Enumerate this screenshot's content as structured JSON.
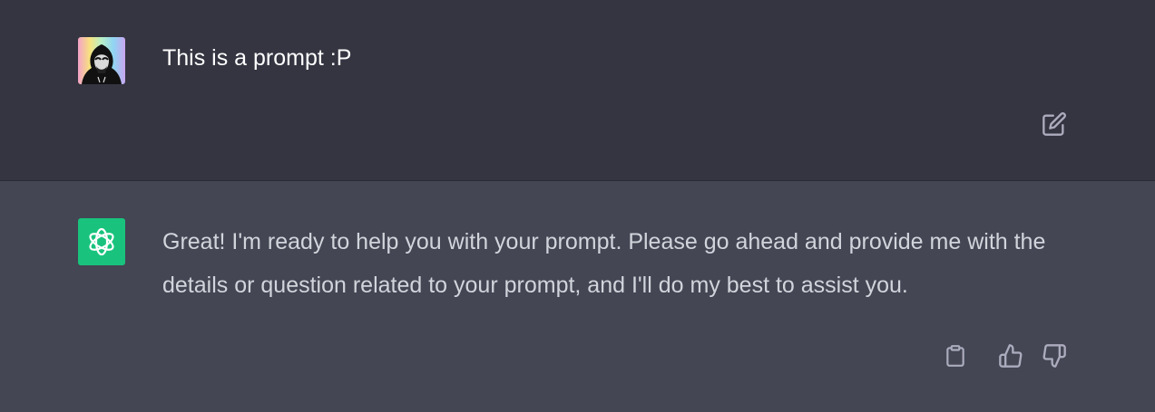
{
  "conversation": {
    "user_message": {
      "text": "This is a prompt :P",
      "avatar_icon": "hooded-user-avatar",
      "edit_icon": "edit-icon"
    },
    "assistant_message": {
      "text": "Great! I'm ready to help you with your prompt. Please go ahead and provide me with the details or question related to your prompt, and I'll do my best to assist you.",
      "avatar_icon": "openai-logo-icon",
      "actions": [
        "copy-icon",
        "thumbs-up-icon",
        "thumbs-down-icon"
      ]
    }
  },
  "colors": {
    "user_bg": "#343541",
    "assistant_bg": "#444654",
    "assistant_avatar_bg": "#19c37d",
    "text": "#ececf1",
    "icon": "#acacbe"
  }
}
